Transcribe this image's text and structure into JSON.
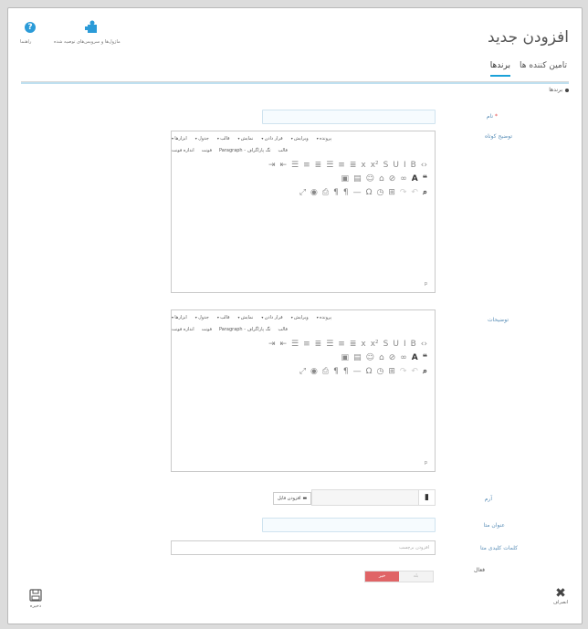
{
  "header": {
    "title": "افزودن جدید",
    "help_label": "راهنما",
    "modules_label": "ماژول‌ها و سرویس‌های توصیه شده"
  },
  "tabs": [
    {
      "label": "برندها",
      "active": true
    },
    {
      "label": "تامین کننده ها",
      "active": false
    }
  ],
  "breadcrumb": "برندها",
  "fields": {
    "name_label": "نام",
    "name_required": "*",
    "short_desc_label": "توضیح کوتاه",
    "description_label": "توضیحات",
    "logo_label": "آرم",
    "add_file_label": "افزودن فایل",
    "meta_title_label": "عنوان متا",
    "meta_keywords_label": "کلمات کلیدی متا",
    "meta_keywords_placeholder": "افزودن برچسب",
    "active_label": "فعال",
    "toggle_yes": "بله",
    "toggle_no": "خیر"
  },
  "editor": {
    "menu": [
      "پرونده",
      "ویرایش",
      "قرار دادن",
      "نمایش",
      "قالب",
      "جدول",
      "ابزارها"
    ],
    "format": [
      "قالب",
      "تگ پاراگراف - Paragraph",
      "فونت",
      "اندازه فونت"
    ],
    "status": "p"
  },
  "footer": {
    "save_label": "ذخیره",
    "cancel_label": "انصراف"
  },
  "colors": {
    "accent": "#1aa1d8",
    "label": "#5b8fb8",
    "toggle_no_active": "#e06466"
  },
  "icons": {
    "help": "question-circle-icon",
    "modules": "puzzle-icon",
    "save": "floppy-disk-icon",
    "cancel": "close-icon",
    "logo_file": "file-icon",
    "add_file": "folder-icon"
  }
}
